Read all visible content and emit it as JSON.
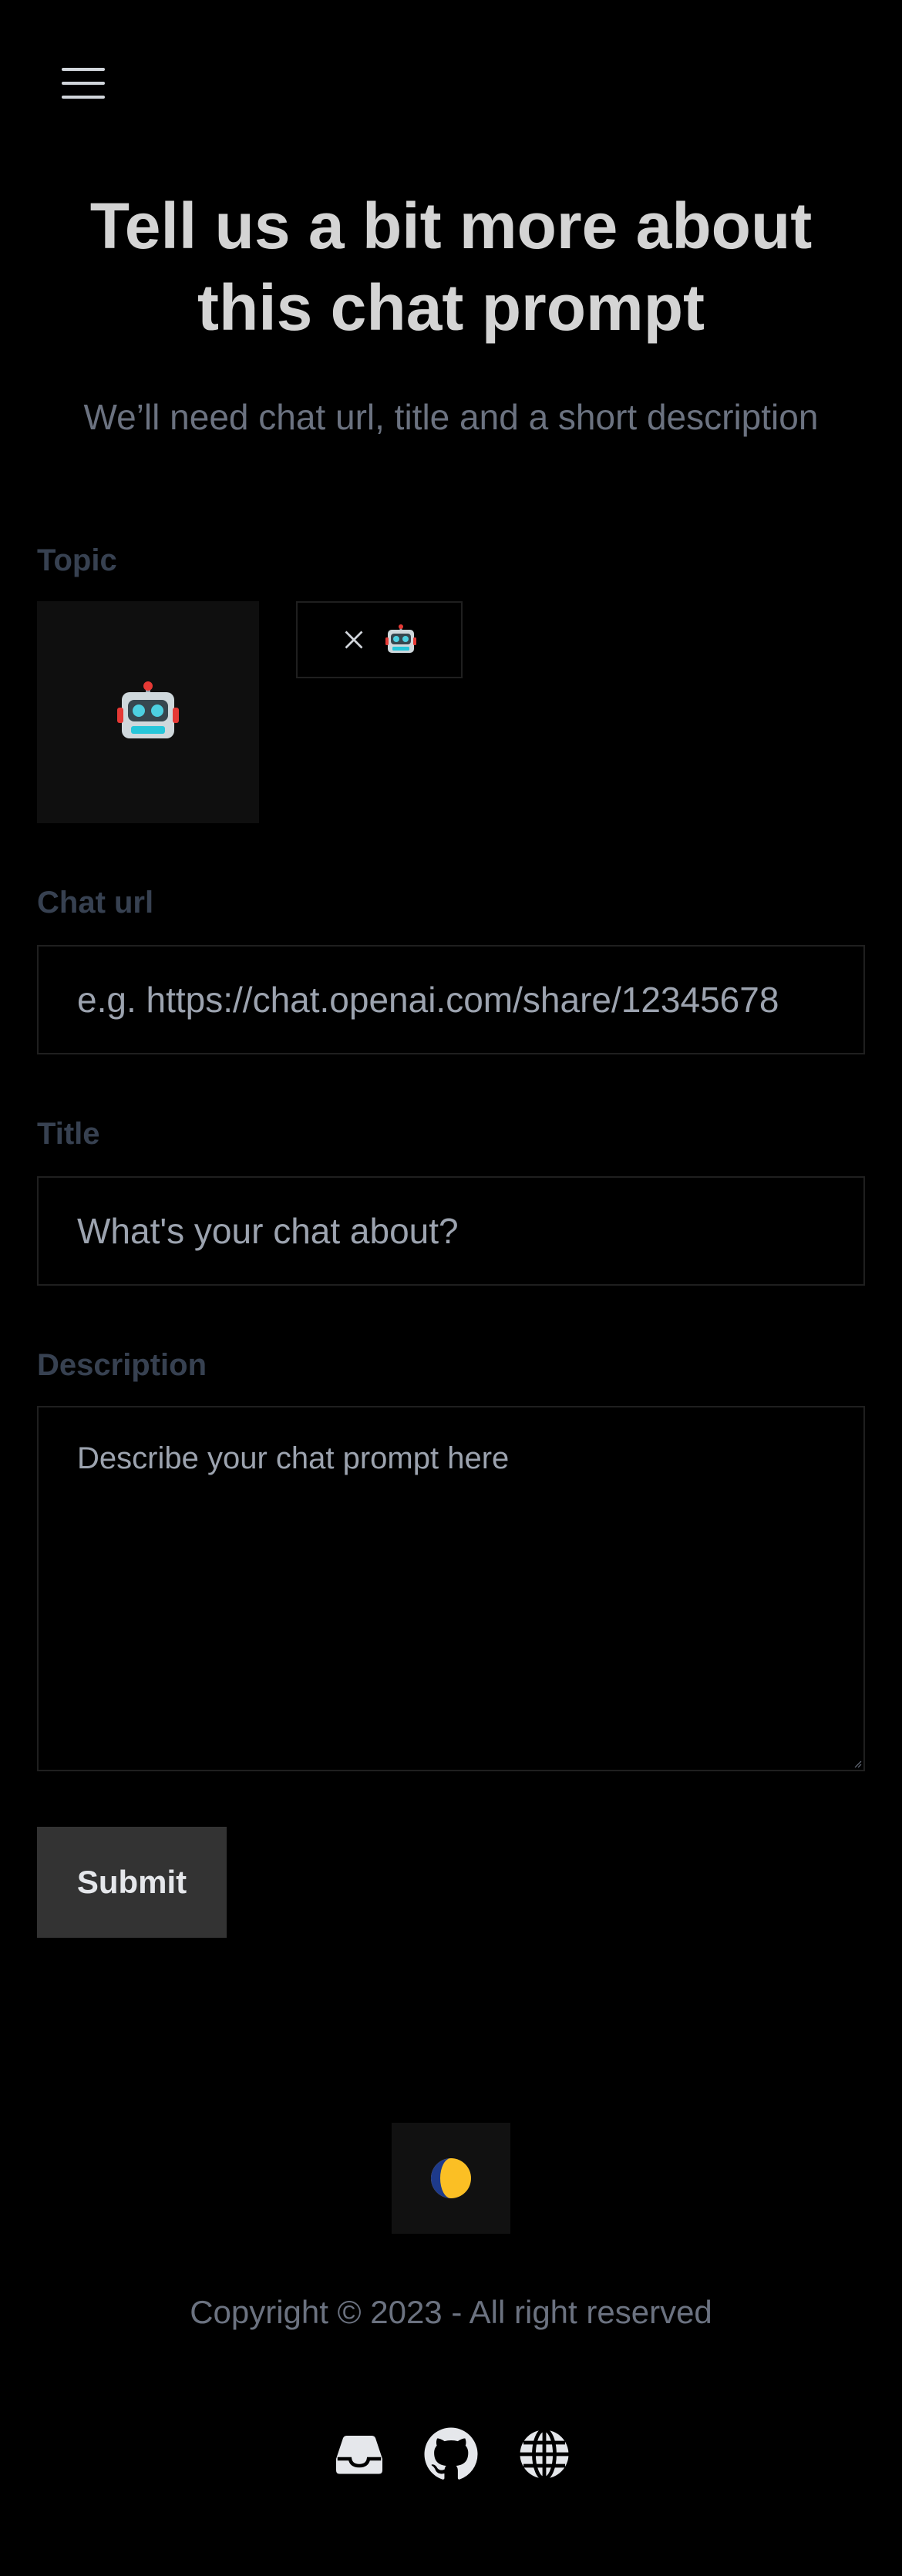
{
  "header": {
    "menu_icon": "hamburger-menu-icon"
  },
  "hero": {
    "title_line1": "Tell us a bit more about",
    "title_line2": "this chat prompt",
    "subtitle": "We’ll need chat url, title and a short description"
  },
  "form": {
    "topic": {
      "label": "Topic",
      "selected_icon": "robot-emoji-icon",
      "chip_close_icon": "close-icon"
    },
    "chat_url": {
      "label": "Chat url",
      "placeholder": "e.g. https://chat.openai.com/share/12345678"
    },
    "title": {
      "label": "Title",
      "placeholder": "What's your chat about?"
    },
    "description": {
      "label": "Description",
      "placeholder": "Describe your chat prompt here"
    },
    "submit_label": "Submit"
  },
  "footer": {
    "theme_icon": "half-moon-icon",
    "copyright": "Copyright © 2023 - All right reserved",
    "social_icons": [
      "inbox-icon",
      "github-icon",
      "globe-icon"
    ]
  },
  "colors": {
    "background": "#000000",
    "text": "#d4d4d4",
    "muted": "#6b7280",
    "label": "#374151",
    "button": "#333333"
  }
}
